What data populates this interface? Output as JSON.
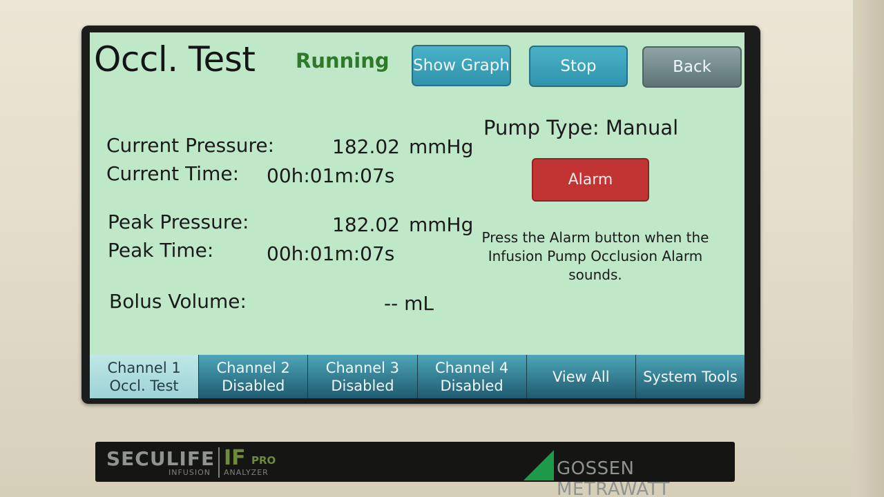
{
  "screen": {
    "title": "Occl. Test",
    "status": "Running",
    "buttons": {
      "show_graph": "Show Graph",
      "stop": "Stop",
      "back": "Back"
    },
    "readings": {
      "current_pressure_label": "Current Pressure:",
      "current_pressure_value": "182.02",
      "current_pressure_unit": "mmHg",
      "current_time_label": "Current Time:",
      "current_time_value": "00h:01m:07s",
      "peak_pressure_label": "Peak Pressure:",
      "peak_pressure_value": "182.02",
      "peak_pressure_unit": "mmHg",
      "peak_time_label": "Peak Time:",
      "peak_time_value": "00h:01m:07s",
      "bolus_volume_label": "Bolus Volume:",
      "bolus_volume_value": "-- mL"
    },
    "pump_type": "Pump Type: Manual",
    "alarm_button": "Alarm",
    "hint": "Press the Alarm button when the Infusion Pump Occlusion Alarm sounds.",
    "tabs": [
      {
        "line1": "Channel 1",
        "line2": "Occl. Test"
      },
      {
        "line1": "Channel 2",
        "line2": "Disabled"
      },
      {
        "line1": "Channel 3",
        "line2": "Disabled"
      },
      {
        "line1": "Channel 4",
        "line2": "Disabled"
      },
      {
        "line1": "View All",
        "line2": ""
      },
      {
        "line1": "System Tools",
        "line2": ""
      }
    ]
  },
  "brand": {
    "seculife": "SECULIFE",
    "infusion": "INFUSION",
    "if": "IF",
    "pro": "PRO",
    "analyzer": "ANALYZER",
    "maker": "GOSSEN METRAWATT"
  },
  "colors": {
    "screen_bg": "#bfe8c8",
    "status_green": "#2f7a2a",
    "button_teal": "#3aa3bb",
    "alarm_red": "#c23434"
  }
}
